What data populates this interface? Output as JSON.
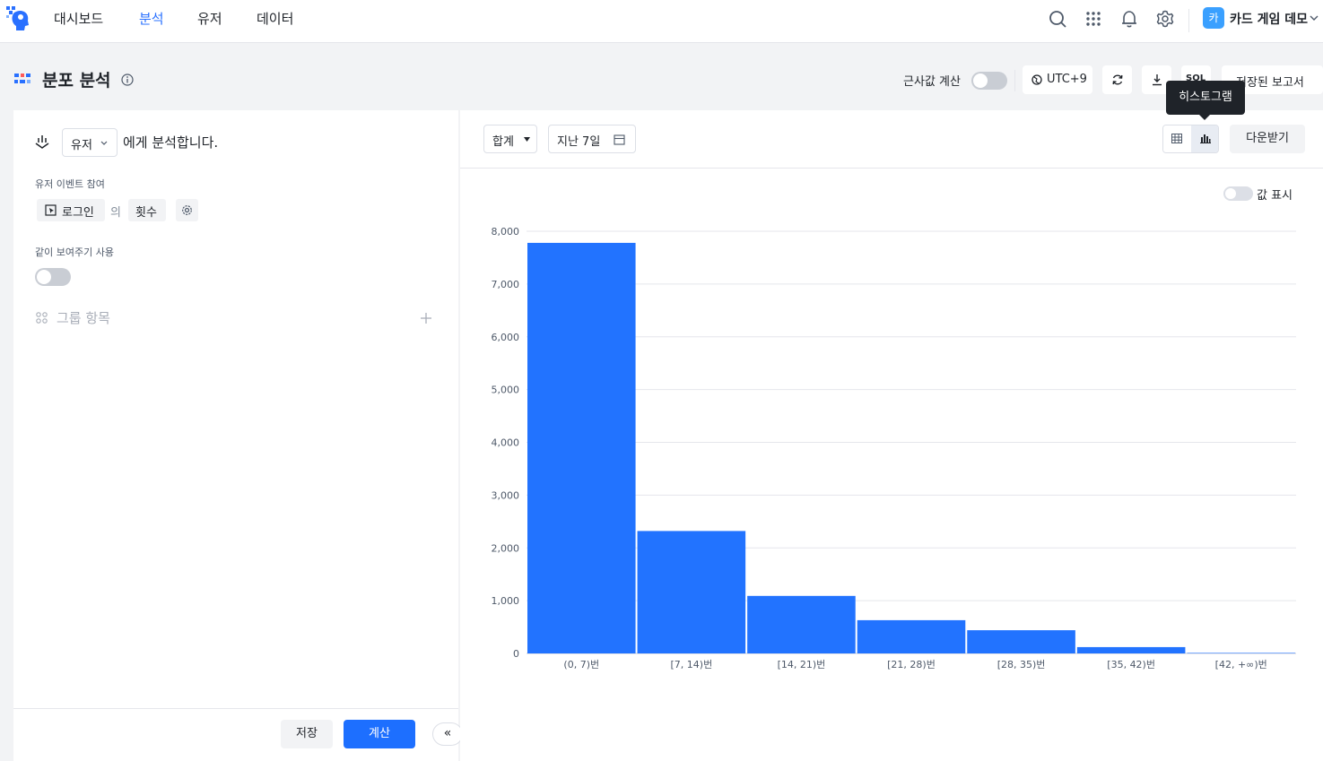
{
  "nav": {
    "items": [
      "대시보드",
      "분석",
      "유저",
      "데이터"
    ],
    "active": "분석",
    "project_avatar": "카",
    "project_name": "카드 게임 데모"
  },
  "header": {
    "title": "분포 분석",
    "approx_label": "근사값 계산",
    "timezone": "UTC+9",
    "sql_label": "SQL",
    "saved_reports": "저장된 보고서"
  },
  "left": {
    "subject": "유저",
    "analyze_text": "에게 분석합니다.",
    "event_section": "유저 이벤트 참여",
    "event_name": "로그인",
    "of_text": "의",
    "metric": "횟수",
    "period_section": "같이 보여주기 사용",
    "group_label": "그룹 항목",
    "save_btn": "저장",
    "calc_btn": "계산",
    "collapse": "«"
  },
  "right": {
    "agg_select": "합계",
    "date_select": "지난 7일",
    "tooltip": "히스토그램",
    "download": "다운받기",
    "show_values": "값 표시"
  },
  "colors": {
    "accent": "#2970ff",
    "bar": "#2273ff"
  },
  "chart_data": {
    "type": "bar",
    "categories": [
      "(0, 7)번",
      "[7, 14)번",
      "[14, 21)번",
      "[21, 28)번",
      "[28, 35)번",
      "[35, 42)번",
      "[42, +∞)번"
    ],
    "values": [
      7780,
      2320,
      1090,
      630,
      440,
      120,
      10
    ],
    "ylim": [
      0,
      8000
    ],
    "yticks": [
      "0",
      "1,000",
      "2,000",
      "3,000",
      "4,000",
      "5,000",
      "6,000",
      "7,000",
      "8,000"
    ],
    "grid": true
  }
}
